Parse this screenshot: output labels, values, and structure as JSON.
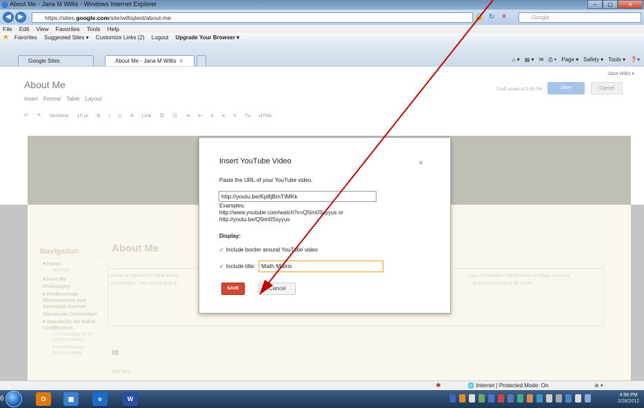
{
  "window": {
    "title": "About Me - Jana M Willis - Windows Internet Explorer",
    "controls": [
      "–",
      "▢",
      "✕"
    ]
  },
  "browser": {
    "url_prefix": "https://sites.",
    "url_domain": "google.com",
    "url_path": "/site/willisjtest/about-me",
    "search_placeholder": "Google",
    "menu": [
      "File",
      "Edit",
      "View",
      "Favorites",
      "Tools",
      "Help"
    ],
    "favorites": {
      "label": "Favorites",
      "items": [
        "Suggested Sites ▾",
        "Customize Links (2)",
        "Logout",
        "Upgrade Your Browser ▾"
      ]
    },
    "tabs": [
      {
        "label": "Google Sites"
      },
      {
        "label": "About Me - Jana M Willis"
      }
    ],
    "commands": [
      "Page ▾",
      "Safety ▾",
      "Tools ▾"
    ]
  },
  "site": {
    "username": "Jana Willis ▾",
    "page_title": "About Me",
    "edit_menu": [
      "Insert",
      "Format",
      "Table",
      "Layout"
    ],
    "saved_status": "Draft saved at 2:55 PM",
    "save_label": "Save",
    "cancel_label": "Cancel",
    "format_bar": [
      "↶",
      "↷",
      "Verdana",
      "10 pt",
      "B",
      "I",
      "U",
      "A",
      "Link",
      "Tx",
      "HTML"
    ],
    "nav": {
      "heading": "Navigation",
      "items": [
        {
          "label": "▾ Home",
          "type": "it"
        },
        {
          "label": "MyFiles",
          "type": "sub"
        },
        {
          "label": "About Me",
          "type": "it"
        },
        {
          "label": "Philosophy",
          "type": "it"
        },
        {
          "label": "▸ Professional Development and Appraisal System",
          "type": "it"
        },
        {
          "label": "Standards Correlation",
          "type": "it"
        },
        {
          "label": "▾ Standards for Initial Certification",
          "type": "it"
        },
        {
          "label": "I. Knowledge of the Subject Matter",
          "type": "sub"
        },
        {
          "label": "II. Professional Responsibility",
          "type": "sub"
        }
      ]
    },
    "content_heading": "About Me",
    "content_left": "Given a moment in time what...\ninformation. You could also d...",
    "content_right": "your education, certification or basic contact\n...ly professional at all times.",
    "add_item": "Add item"
  },
  "dialog": {
    "title": "Insert YouTube Video",
    "close": "×",
    "url_prompt": "Paste the URL of your YouTube video.",
    "url_value": "http://youtu.be/Kp8jBmTtMKk",
    "examples_label": "Examples:",
    "example1": "http://www.youtube.com/watch?v=Q5im0Ssyyus or",
    "example2": "http://youtu.be/Q5im0Ssyyus",
    "display_label": "Display:",
    "border_option": "Include border around YouTube video",
    "title_option": "Include title:",
    "title_value": "Math Matrix",
    "save": "SAVE",
    "cancel": "Cancel"
  },
  "statusbar": {
    "zone": "Internet | Protected Mode: On",
    "zoom": "⊕ ▾"
  },
  "taskbar": {
    "apps": [
      "O",
      "▦",
      "e",
      "W"
    ],
    "time": "4:56 PM",
    "date": "2/28/2012",
    "left_edge_text": "6"
  },
  "colors": {
    "save_red": "#d14836",
    "focus_orange": "#e0a020",
    "arrow_red": "#c00000"
  }
}
